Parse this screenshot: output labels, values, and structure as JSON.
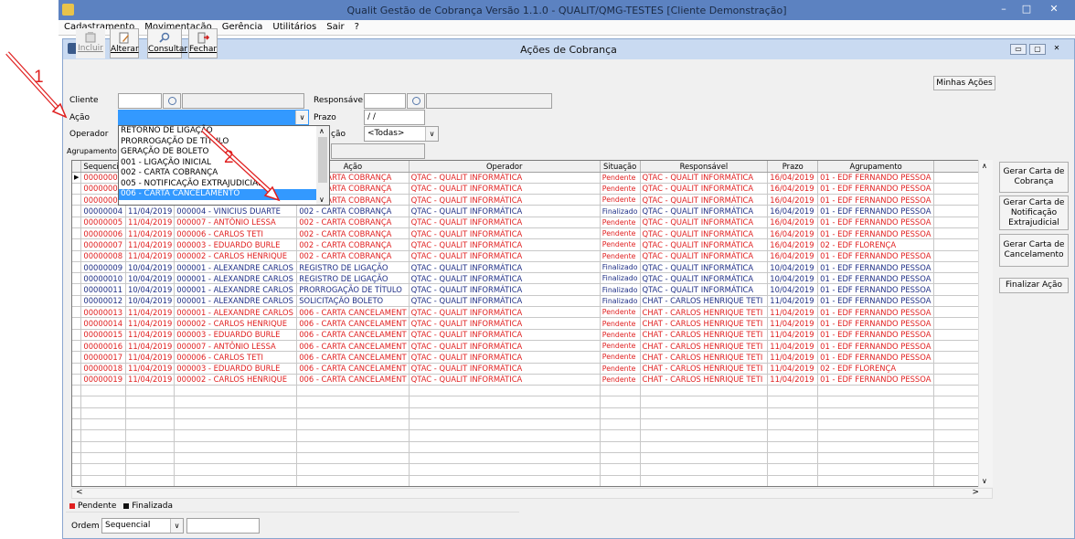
{
  "app": {
    "title": "Qualit Gestão de Cobrança Versão 1.1.0 - QUALIT/QMG-TESTES [Cliente Demonstração]",
    "controls": [
      "–",
      "□",
      "✕"
    ]
  },
  "menu": [
    "Cadastramento",
    "Movimentação",
    "Gerência",
    "Utilitários",
    "Sair",
    "?"
  ],
  "window": {
    "title": "Ações de Cobrança",
    "controls": [
      "▭",
      "▢",
      "✕"
    ]
  },
  "toolbar": {
    "incluir": "Incluir",
    "alterar": "Alterar",
    "consultar": "Consultar",
    "fechar": "Fechar",
    "minhas_acoes": "Minhas Ações"
  },
  "filters": {
    "cliente_label": "Cliente",
    "acao_label": "Ação",
    "operador_label": "Operador",
    "agrupamento_label": "Agrupamento",
    "responsavel_label": "Responsável",
    "prazo_label": "Prazo",
    "prazo_value": " / /",
    "situacao_label_partial": "ção",
    "situacao_value": "<Todas>"
  },
  "dropdown": {
    "options": [
      "RETORNO DE LIGAÇÃO",
      "PRORROGAÇÃO DE TÍTULO",
      "GERAÇÃO DE BOLETO",
      "001 - LIGAÇÃO INICIAL",
      "002 - CARTA COBRANÇA",
      "005 - NOTIFICAÇÃO EXTRAJUDICIAL",
      "006 - CARTA CANCELAMENTO"
    ],
    "selected_index": 6
  },
  "grid": {
    "headers": [
      "Sequencia",
      "",
      "",
      "Ação",
      "Operador",
      "Situação",
      "Responsável",
      "Prazo",
      "Agrupamento"
    ],
    "rows": [
      {
        "seq": "00000001",
        "data": "",
        "cliente": "",
        "acao": "002 - CARTA COBRANÇA",
        "operador": "QTAC - QUALIT INFORMÁTICA",
        "situacao": "Pendente",
        "responsavel": "QTAC - QUALIT INFORMÁTICA",
        "prazo": "16/04/2019",
        "agrupamento": "01 - EDF FERNANDO PESSOA",
        "status": "pend"
      },
      {
        "seq": "00000002",
        "data": "",
        "cliente": "",
        "acao": "002 - CARTA COBRANÇA",
        "operador": "QTAC - QUALIT INFORMÁTICA",
        "situacao": "Pendente",
        "responsavel": "QTAC - QUALIT INFORMÁTICA",
        "prazo": "16/04/2019",
        "agrupamento": "01 - EDF FERNANDO PESSOA",
        "status": "pend"
      },
      {
        "seq": "00000003",
        "data": "",
        "cliente": "",
        "acao": "002 - CARTA COBRANÇA",
        "operador": "QTAC - QUALIT INFORMÁTICA",
        "situacao": "Pendente",
        "responsavel": "QTAC - QUALIT INFORMÁTICA",
        "prazo": "16/04/2019",
        "agrupamento": "01 - EDF FERNANDO PESSOA",
        "status": "pend"
      },
      {
        "seq": "00000004",
        "data": "11/04/2019",
        "cliente": "000004 - VINICIUS DUARTE",
        "acao": "002 - CARTA COBRANÇA",
        "operador": "QTAC - QUALIT INFORMÁTICA",
        "situacao": "Finalizado",
        "responsavel": "QTAC - QUALIT INFORMÁTICA",
        "prazo": "16/04/2019",
        "agrupamento": "01 - EDF FERNANDO PESSOA",
        "status": "fin"
      },
      {
        "seq": "00000005",
        "data": "11/04/2019",
        "cliente": "000007 - ANTÔNIO LESSA",
        "acao": "002 - CARTA COBRANÇA",
        "operador": "QTAC - QUALIT INFORMÁTICA",
        "situacao": "Pendente",
        "responsavel": "QTAC - QUALIT INFORMÁTICA",
        "prazo": "16/04/2019",
        "agrupamento": "01 - EDF FERNANDO PESSOA",
        "status": "pend"
      },
      {
        "seq": "00000006",
        "data": "11/04/2019",
        "cliente": "000006 - CARLOS TETI",
        "acao": "002 - CARTA COBRANÇA",
        "operador": "QTAC - QUALIT INFORMÁTICA",
        "situacao": "Pendente",
        "responsavel": "QTAC - QUALIT INFORMÁTICA",
        "prazo": "16/04/2019",
        "agrupamento": "01 - EDF FERNANDO PESSOA",
        "status": "pend"
      },
      {
        "seq": "00000007",
        "data": "11/04/2019",
        "cliente": "000003 - EDUARDO BURLE",
        "acao": "002 - CARTA COBRANÇA",
        "operador": "QTAC - QUALIT INFORMÁTICA",
        "situacao": "Pendente",
        "responsavel": "QTAC - QUALIT INFORMÁTICA",
        "prazo": "16/04/2019",
        "agrupamento": "02 - EDF FLORENÇA",
        "status": "pend"
      },
      {
        "seq": "00000008",
        "data": "11/04/2019",
        "cliente": "000002 - CARLOS HENRIQUE",
        "acao": "002 - CARTA COBRANÇA",
        "operador": "QTAC - QUALIT INFORMÁTICA",
        "situacao": "Pendente",
        "responsavel": "QTAC - QUALIT INFORMÁTICA",
        "prazo": "16/04/2019",
        "agrupamento": "01 - EDF FERNANDO PESSOA",
        "status": "pend"
      },
      {
        "seq": "00000009",
        "data": "10/04/2019",
        "cliente": "000001 - ALEXANDRE CARLOS",
        "acao": "REGISTRO DE LIGAÇÃO",
        "operador": "QTAC - QUALIT INFORMÁTICA",
        "situacao": "Finalizado",
        "responsavel": "QTAC - QUALIT INFORMÁTICA",
        "prazo": "10/04/2019",
        "agrupamento": "01 - EDF FERNANDO PESSOA",
        "status": "fin"
      },
      {
        "seq": "00000010",
        "data": "10/04/2019",
        "cliente": "000001 - ALEXANDRE CARLOS",
        "acao": "REGISTRO DE LIGAÇÃO",
        "operador": "QTAC - QUALIT INFORMÁTICA",
        "situacao": "Finalizado",
        "responsavel": "QTAC - QUALIT INFORMÁTICA",
        "prazo": "10/04/2019",
        "agrupamento": "01 - EDF FERNANDO PESSOA",
        "status": "fin"
      },
      {
        "seq": "00000011",
        "data": "10/04/2019",
        "cliente": "000001 - ALEXANDRE CARLOS",
        "acao": "PRORROGAÇÃO DE TÍTULO",
        "operador": "QTAC - QUALIT INFORMÁTICA",
        "situacao": "Finalizado",
        "responsavel": "QTAC - QUALIT INFORMÁTICA",
        "prazo": "10/04/2019",
        "agrupamento": "01 - EDF FERNANDO PESSOA",
        "status": "fin"
      },
      {
        "seq": "00000012",
        "data": "10/04/2019",
        "cliente": "000001 - ALEXANDRE CARLOS",
        "acao": "SOLICITAÇÃO BOLETO",
        "operador": "QTAC - QUALIT INFORMÁTICA",
        "situacao": "Finalizado",
        "responsavel": "CHAT - CARLOS HENRIQUE TETI",
        "prazo": "11/04/2019",
        "agrupamento": "01 - EDF FERNANDO PESSOA",
        "status": "fin"
      },
      {
        "seq": "00000013",
        "data": "11/04/2019",
        "cliente": "000001 - ALEXANDRE CARLOS",
        "acao": "006 - CARTA CANCELAMENT",
        "operador": "QTAC - QUALIT INFORMÁTICA",
        "situacao": "Pendente",
        "responsavel": "CHAT - CARLOS HENRIQUE TETI",
        "prazo": "11/04/2019",
        "agrupamento": "01 - EDF FERNANDO PESSOA",
        "status": "pend"
      },
      {
        "seq": "00000014",
        "data": "11/04/2019",
        "cliente": "000002 - CARLOS HENRIQUE",
        "acao": "006 - CARTA CANCELAMENT",
        "operador": "QTAC - QUALIT INFORMÁTICA",
        "situacao": "Pendente",
        "responsavel": "CHAT - CARLOS HENRIQUE TETI",
        "prazo": "11/04/2019",
        "agrupamento": "01 - EDF FERNANDO PESSOA",
        "status": "pend"
      },
      {
        "seq": "00000015",
        "data": "11/04/2019",
        "cliente": "000003 - EDUARDO BURLE",
        "acao": "006 - CARTA CANCELAMENT",
        "operador": "QTAC - QUALIT INFORMÁTICA",
        "situacao": "Pendente",
        "responsavel": "CHAT - CARLOS HENRIQUE TETI",
        "prazo": "11/04/2019",
        "agrupamento": "01 - EDF FERNANDO PESSOA",
        "status": "pend"
      },
      {
        "seq": "00000016",
        "data": "11/04/2019",
        "cliente": "000007 - ANTÔNIO LESSA",
        "acao": "006 - CARTA CANCELAMENT",
        "operador": "QTAC - QUALIT INFORMÁTICA",
        "situacao": "Pendente",
        "responsavel": "CHAT - CARLOS HENRIQUE TETI",
        "prazo": "11/04/2019",
        "agrupamento": "01 - EDF FERNANDO PESSOA",
        "status": "pend"
      },
      {
        "seq": "00000017",
        "data": "11/04/2019",
        "cliente": "000006 - CARLOS TETI",
        "acao": "006 - CARTA CANCELAMENT",
        "operador": "QTAC - QUALIT INFORMÁTICA",
        "situacao": "Pendente",
        "responsavel": "CHAT - CARLOS HENRIQUE TETI",
        "prazo": "11/04/2019",
        "agrupamento": "01 - EDF FERNANDO PESSOA",
        "status": "pend"
      },
      {
        "seq": "00000018",
        "data": "11/04/2019",
        "cliente": "000003 - EDUARDO BURLE",
        "acao": "006 - CARTA CANCELAMENT",
        "operador": "QTAC - QUALIT INFORMÁTICA",
        "situacao": "Pendente",
        "responsavel": "CHAT - CARLOS HENRIQUE TETI",
        "prazo": "11/04/2019",
        "agrupamento": "02 - EDF FLORENÇA",
        "status": "pend"
      },
      {
        "seq": "00000019",
        "data": "11/04/2019",
        "cliente": "000002 - CARLOS HENRIQUE",
        "acao": "006 - CARTA CANCELAMENT",
        "operador": "QTAC - QUALIT INFORMÁTICA",
        "situacao": "Pendente",
        "responsavel": "CHAT - CARLOS HENRIQUE TETI",
        "prazo": "11/04/2019",
        "agrupamento": "01 - EDF FERNANDO PESSOA",
        "status": "pend"
      }
    ],
    "empty_rows": 11
  },
  "side_buttons": {
    "carta_cobranca": "Gerar Carta de Cobrança",
    "carta_notificacao": "Gerar Carta de Notificação Extrajudicial",
    "carta_cancelamento": "Gerar Carta de Cancelamento",
    "finalizar": "Finalizar Ação"
  },
  "legend": {
    "pendente": "Pendente",
    "finalizada": "Finalizada"
  },
  "order": {
    "label": "Ordem",
    "value": "Sequencial"
  },
  "annotations": {
    "label1": "1",
    "label2": "2"
  },
  "colors": {
    "pending": "#e02020",
    "finished": "#1f2f86",
    "selection": "#3399ff",
    "annotation": "#e02020"
  }
}
